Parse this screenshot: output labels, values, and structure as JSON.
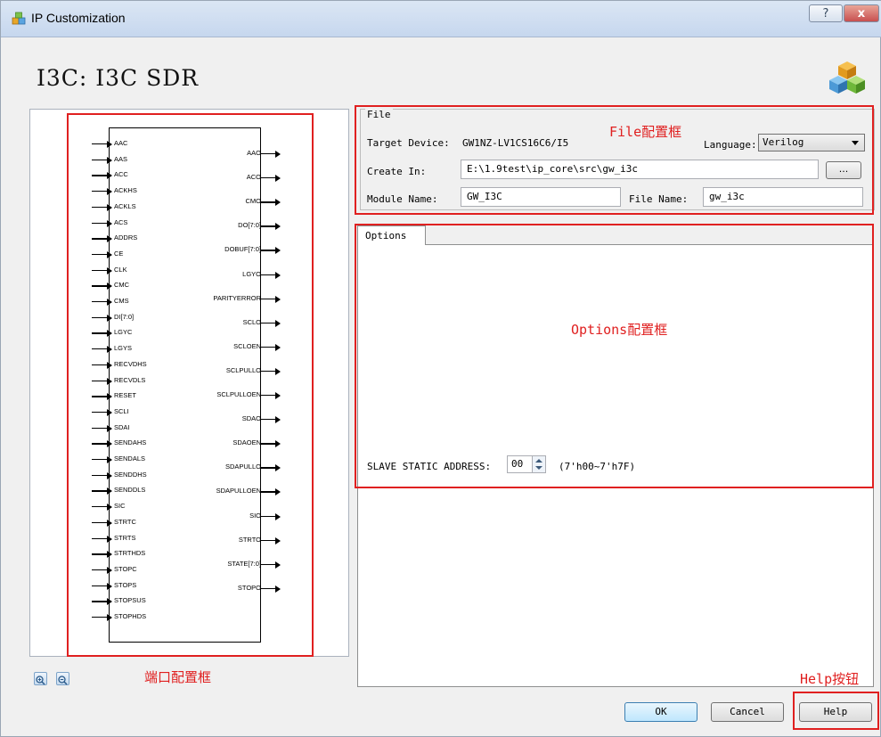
{
  "window": {
    "title": "IP Customization",
    "help_glyph": "?",
    "close_glyph": "x"
  },
  "heading": "I3C: I3C SDR",
  "schematic": {
    "inputs": [
      "AAC",
      "AAS",
      "ACC",
      "ACKHS",
      "ACKLS",
      "ACS",
      "ADDRS",
      "CE",
      "CLK",
      "CMC",
      "CMS",
      "DI[7:0]",
      "LGYC",
      "LGYS",
      "RECVDHS",
      "RECVDLS",
      "RESET",
      "SCLI",
      "SDAI",
      "SENDAHS",
      "SENDALS",
      "SENDDHS",
      "SENDDLS",
      "SIC",
      "STRTC",
      "STRTS",
      "STRTHDS",
      "STOPC",
      "STOPS",
      "STOPSUS",
      "STOPHDS"
    ],
    "outputs": [
      "AAO",
      "ACO",
      "CMO",
      "DO[7:0]",
      "DOBUF[7:0]",
      "LGYO",
      "PARITYERROR",
      "SCLO",
      "SCLOEN",
      "SCLPULLO",
      "SCLPULLOEN",
      "SDAO",
      "SDAOEN",
      "SDAPULLO",
      "SDAPULLOEN",
      "SIO",
      "STRTO",
      "STATE[7:0]",
      "STOPO"
    ]
  },
  "file": {
    "group_title": "File",
    "target_device_label": "Target Device:",
    "target_device": "GW1NZ-LV1CS16C6/I5",
    "language_label": "Language:",
    "language": "Verilog",
    "create_in_label": "Create In:",
    "create_in": "E:\\1.9test\\ip_core\\src\\gw_i3c",
    "browse_label": "...",
    "module_name_label": "Module Name:",
    "module_name": "GW_I3C",
    "file_name_label": "File Name:",
    "file_name": "gw_i3c"
  },
  "options": {
    "tab_label": "Options",
    "slave_addr_label": "SLAVE STATIC ADDRESS:",
    "slave_addr_value": "00",
    "slave_addr_range": "(7'h00~7'h7F)"
  },
  "annotations": {
    "file_box": "File配置框",
    "options_box": "Options配置框",
    "port_box": "端口配置框",
    "help_button": "Help按钮"
  },
  "buttons": {
    "ok": "OK",
    "cancel": "Cancel",
    "help": "Help"
  },
  "colors": {
    "annotation_red": "#e02020",
    "title_gradient_top": "#dbe6f4"
  }
}
